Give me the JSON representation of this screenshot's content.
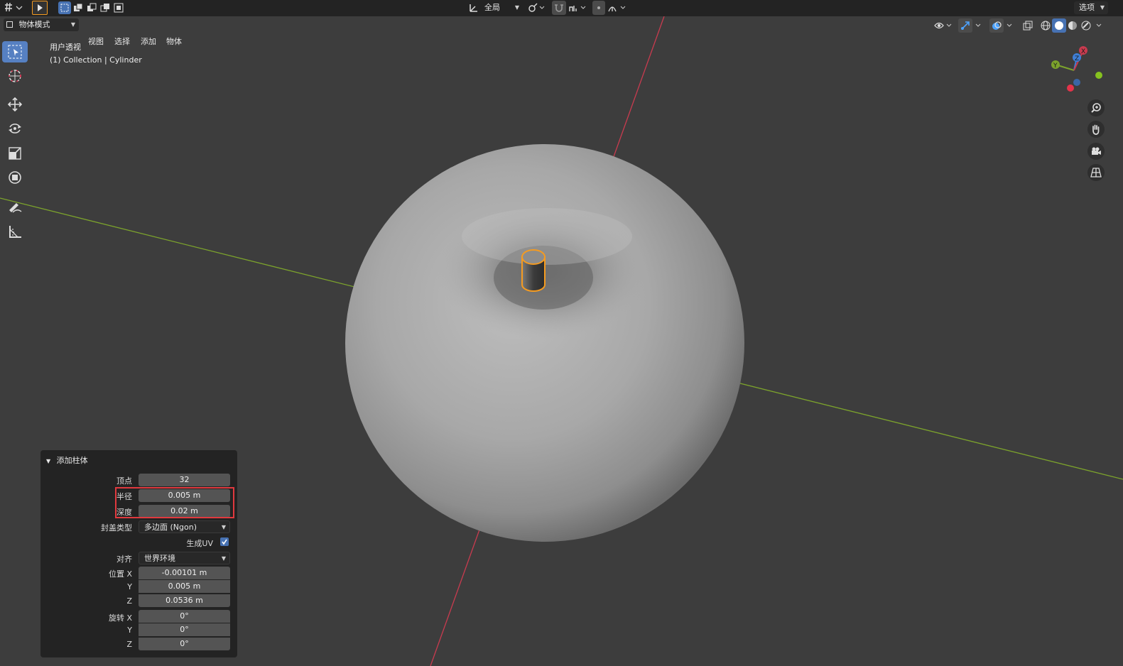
{
  "header": {
    "transform_orientation": "全局",
    "options_label": "选项",
    "mode": "物体模式",
    "menu": [
      "视图",
      "选择",
      "添加",
      "物体"
    ]
  },
  "viewport": {
    "view_name": "用户透视",
    "object_info": "(1) Collection | Cylinder",
    "gizmo_axes": [
      "X",
      "Y",
      "Z"
    ]
  },
  "tools": [
    "select-box",
    "cursor",
    "move",
    "rotate",
    "scale",
    "transform",
    "annotate",
    "measure"
  ],
  "redo_panel": {
    "title": "添加柱体",
    "vertices_label": "顶点",
    "vertices": "32",
    "radius_label": "半径",
    "radius": "0.005 m",
    "depth_label": "深度",
    "depth": "0.02 m",
    "cap_fill_label": "封盖类型",
    "cap_fill": "多边面 (Ngon)",
    "generate_uv_label": "生成UV",
    "generate_uv": true,
    "align_label": "对齐",
    "align": "世界环境",
    "location_label": "位置",
    "location": {
      "x": "-0.00101 m",
      "y": "0.005 m",
      "z": "0.0536 m"
    },
    "rotation_label": "旋转",
    "rotation": {
      "x": "0°",
      "y": "0°",
      "z": "0°"
    },
    "axis": {
      "x": "X",
      "y": "Y",
      "z": "Z"
    }
  },
  "colors": {
    "accent": "#4772b3",
    "highlight": "#e0393e",
    "selection_outline": "#f59b20",
    "x_axis": "#c93b4f",
    "y_axis": "#7ca32c"
  }
}
